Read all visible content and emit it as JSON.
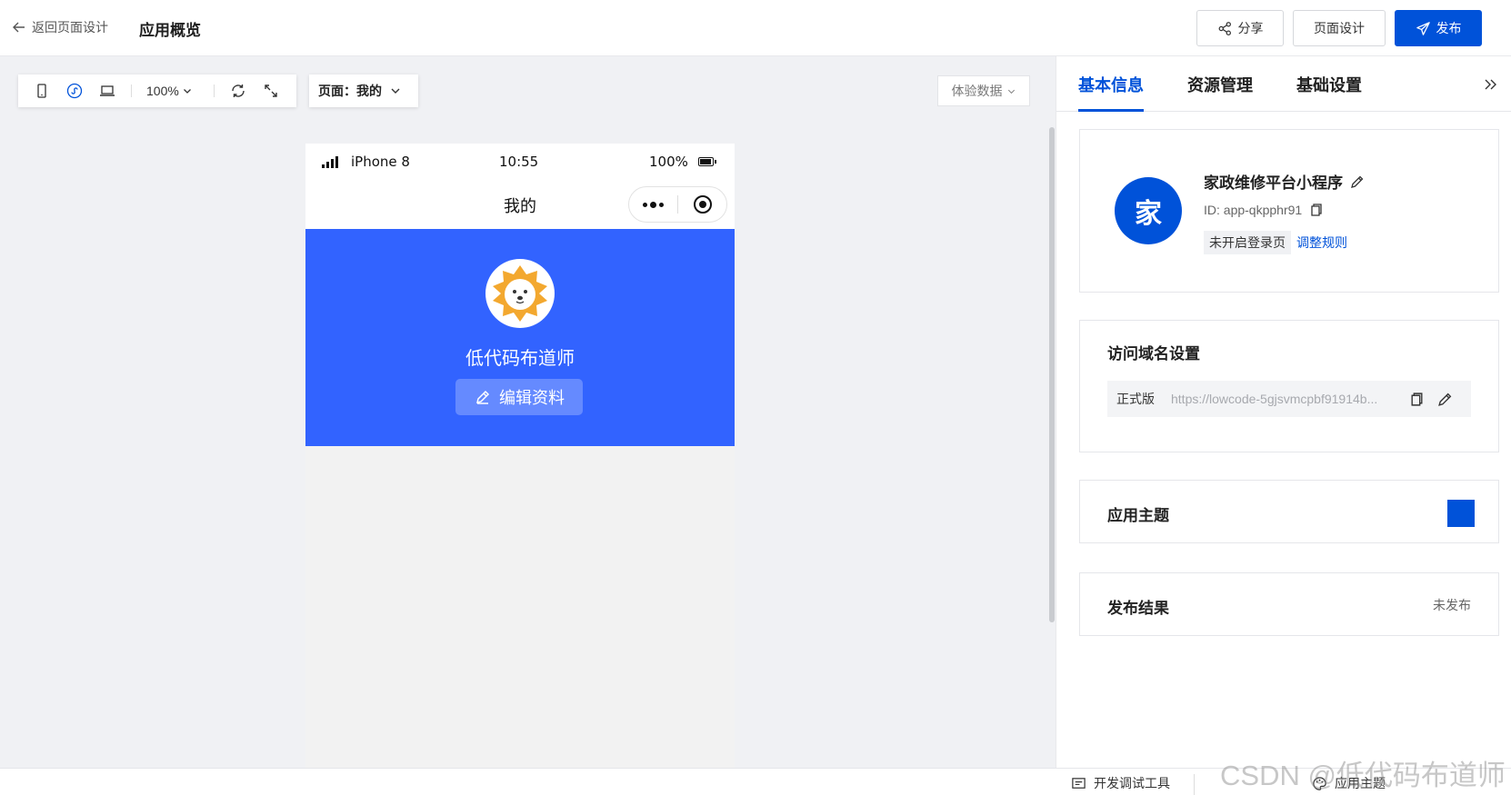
{
  "header": {
    "back_label": "返回页面设计",
    "title": "应用概览",
    "share_label": "分享",
    "design_label": "页面设计",
    "publish_label": "发布"
  },
  "canvas_toolbar": {
    "zoom": "100%",
    "page_label": "页面：我的",
    "experience_data_label": "体验数据"
  },
  "phone": {
    "carrier": "iPhone 8",
    "time": "10:55",
    "battery": "100%",
    "nav_title": "我的",
    "username": "低代码布道师",
    "edit_label": "编辑资料"
  },
  "right_panel": {
    "tabs": [
      {
        "label": "基本信息",
        "active": true
      },
      {
        "label": "资源管理",
        "active": false
      },
      {
        "label": "基础设置",
        "active": false
      }
    ],
    "app": {
      "logo_char": "家",
      "name": "家政维修平台小程序",
      "id": "ID: app-qkpphr91",
      "login_status": "未开启登录页",
      "login_link": "调整规则"
    },
    "domain": {
      "title": "访问域名设置",
      "env": "正式版",
      "url": "https://lowcode-5gjsvmcpbf91914b..."
    },
    "theme": {
      "title": "应用主题",
      "color": "#0052d9"
    },
    "result": {
      "title": "发布结果",
      "status": "未发布"
    }
  },
  "bottom_bar": {
    "dev_tools_label": "开发调试工具",
    "theme_label": "应用主题"
  },
  "watermark": "CSDN @低代码布道师",
  "colors": {
    "brand": "#0052d9",
    "banner": "#3263ff",
    "canvas_bg": "#f0f1f4"
  }
}
